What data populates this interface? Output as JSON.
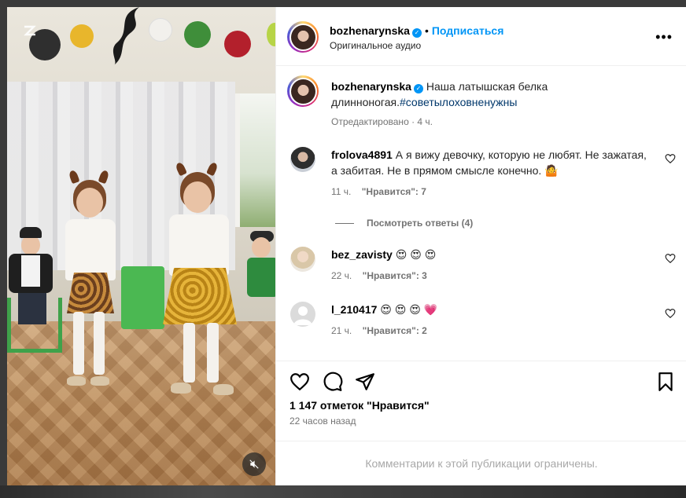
{
  "post": {
    "author": "bozhenarynska",
    "follow_label": "Подписаться",
    "audio_label": "Оригинальное аудио",
    "caption_text": "Наша латышская белка длинноногая.",
    "caption_tag": "#советылоховненужны",
    "caption_meta": "Отредактировано · 4 ч.",
    "likes_text": "1 147 отметок \"Нравится\"",
    "time_ago": "22 часов назад",
    "restricted_text": "Комментарии к этой публикации ограничены."
  },
  "comments": [
    {
      "username": "frolova4891",
      "text": "А я вижу девочку, которую не любят. Не зажатая, а забитая. Не в прямом смысле конечно.",
      "emoji": "🤷",
      "time": "11 ч.",
      "likes": "\"Нравится\": 7",
      "replies_label": "Посмотреть ответы (4)"
    },
    {
      "username": "bez_zavisty",
      "text": "😍 😍 😍",
      "time": "22 ч.",
      "likes": "\"Нравится\": 3"
    },
    {
      "username": "l_210417",
      "text": "😍 😍 😍 💗",
      "time": "21 ч.",
      "likes": "\"Нравится\": 2"
    }
  ],
  "icons": {
    "more": "more-icon",
    "like": "heart-icon",
    "comment": "comment-icon",
    "share": "share-icon",
    "save": "bookmark-icon",
    "mute": "muted-speaker-icon",
    "verified": "verified-badge-icon"
  },
  "colors": {
    "accent": "#0095f6",
    "muted_text": "#737373",
    "tag": "#00376b"
  }
}
